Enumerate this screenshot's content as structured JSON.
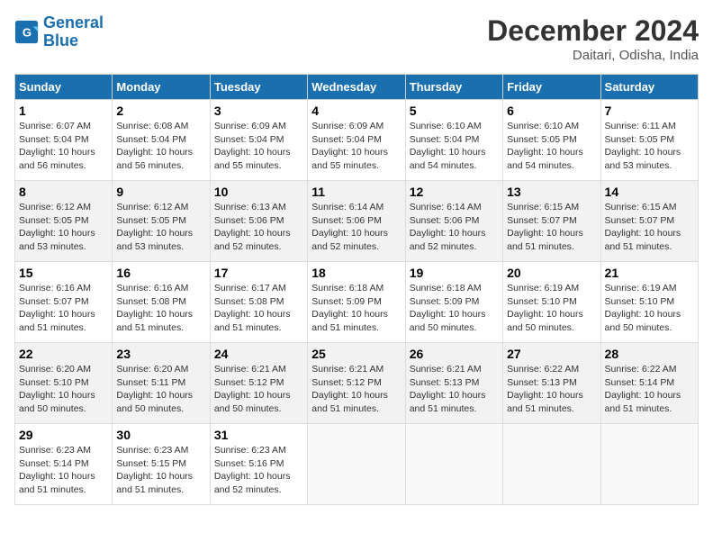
{
  "logo": {
    "line1": "General",
    "line2": "Blue"
  },
  "title": "December 2024",
  "subtitle": "Daitari, Odisha, India",
  "days_header": [
    "Sunday",
    "Monday",
    "Tuesday",
    "Wednesday",
    "Thursday",
    "Friday",
    "Saturday"
  ],
  "weeks": [
    [
      {
        "day": "1",
        "info": "Sunrise: 6:07 AM\nSunset: 5:04 PM\nDaylight: 10 hours\nand 56 minutes."
      },
      {
        "day": "2",
        "info": "Sunrise: 6:08 AM\nSunset: 5:04 PM\nDaylight: 10 hours\nand 56 minutes."
      },
      {
        "day": "3",
        "info": "Sunrise: 6:09 AM\nSunset: 5:04 PM\nDaylight: 10 hours\nand 55 minutes."
      },
      {
        "day": "4",
        "info": "Sunrise: 6:09 AM\nSunset: 5:04 PM\nDaylight: 10 hours\nand 55 minutes."
      },
      {
        "day": "5",
        "info": "Sunrise: 6:10 AM\nSunset: 5:04 PM\nDaylight: 10 hours\nand 54 minutes."
      },
      {
        "day": "6",
        "info": "Sunrise: 6:10 AM\nSunset: 5:05 PM\nDaylight: 10 hours\nand 54 minutes."
      },
      {
        "day": "7",
        "info": "Sunrise: 6:11 AM\nSunset: 5:05 PM\nDaylight: 10 hours\nand 53 minutes."
      }
    ],
    [
      {
        "day": "8",
        "info": "Sunrise: 6:12 AM\nSunset: 5:05 PM\nDaylight: 10 hours\nand 53 minutes."
      },
      {
        "day": "9",
        "info": "Sunrise: 6:12 AM\nSunset: 5:05 PM\nDaylight: 10 hours\nand 53 minutes."
      },
      {
        "day": "10",
        "info": "Sunrise: 6:13 AM\nSunset: 5:06 PM\nDaylight: 10 hours\nand 52 minutes."
      },
      {
        "day": "11",
        "info": "Sunrise: 6:14 AM\nSunset: 5:06 PM\nDaylight: 10 hours\nand 52 minutes."
      },
      {
        "day": "12",
        "info": "Sunrise: 6:14 AM\nSunset: 5:06 PM\nDaylight: 10 hours\nand 52 minutes."
      },
      {
        "day": "13",
        "info": "Sunrise: 6:15 AM\nSunset: 5:07 PM\nDaylight: 10 hours\nand 51 minutes."
      },
      {
        "day": "14",
        "info": "Sunrise: 6:15 AM\nSunset: 5:07 PM\nDaylight: 10 hours\nand 51 minutes."
      }
    ],
    [
      {
        "day": "15",
        "info": "Sunrise: 6:16 AM\nSunset: 5:07 PM\nDaylight: 10 hours\nand 51 minutes."
      },
      {
        "day": "16",
        "info": "Sunrise: 6:16 AM\nSunset: 5:08 PM\nDaylight: 10 hours\nand 51 minutes."
      },
      {
        "day": "17",
        "info": "Sunrise: 6:17 AM\nSunset: 5:08 PM\nDaylight: 10 hours\nand 51 minutes."
      },
      {
        "day": "18",
        "info": "Sunrise: 6:18 AM\nSunset: 5:09 PM\nDaylight: 10 hours\nand 51 minutes."
      },
      {
        "day": "19",
        "info": "Sunrise: 6:18 AM\nSunset: 5:09 PM\nDaylight: 10 hours\nand 50 minutes."
      },
      {
        "day": "20",
        "info": "Sunrise: 6:19 AM\nSunset: 5:10 PM\nDaylight: 10 hours\nand 50 minutes."
      },
      {
        "day": "21",
        "info": "Sunrise: 6:19 AM\nSunset: 5:10 PM\nDaylight: 10 hours\nand 50 minutes."
      }
    ],
    [
      {
        "day": "22",
        "info": "Sunrise: 6:20 AM\nSunset: 5:10 PM\nDaylight: 10 hours\nand 50 minutes."
      },
      {
        "day": "23",
        "info": "Sunrise: 6:20 AM\nSunset: 5:11 PM\nDaylight: 10 hours\nand 50 minutes."
      },
      {
        "day": "24",
        "info": "Sunrise: 6:21 AM\nSunset: 5:12 PM\nDaylight: 10 hours\nand 50 minutes."
      },
      {
        "day": "25",
        "info": "Sunrise: 6:21 AM\nSunset: 5:12 PM\nDaylight: 10 hours\nand 51 minutes."
      },
      {
        "day": "26",
        "info": "Sunrise: 6:21 AM\nSunset: 5:13 PM\nDaylight: 10 hours\nand 51 minutes."
      },
      {
        "day": "27",
        "info": "Sunrise: 6:22 AM\nSunset: 5:13 PM\nDaylight: 10 hours\nand 51 minutes."
      },
      {
        "day": "28",
        "info": "Sunrise: 6:22 AM\nSunset: 5:14 PM\nDaylight: 10 hours\nand 51 minutes."
      }
    ],
    [
      {
        "day": "29",
        "info": "Sunrise: 6:23 AM\nSunset: 5:14 PM\nDaylight: 10 hours\nand 51 minutes."
      },
      {
        "day": "30",
        "info": "Sunrise: 6:23 AM\nSunset: 5:15 PM\nDaylight: 10 hours\nand 51 minutes."
      },
      {
        "day": "31",
        "info": "Sunrise: 6:23 AM\nSunset: 5:16 PM\nDaylight: 10 hours\nand 52 minutes."
      },
      {
        "day": "",
        "info": ""
      },
      {
        "day": "",
        "info": ""
      },
      {
        "day": "",
        "info": ""
      },
      {
        "day": "",
        "info": ""
      }
    ]
  ]
}
